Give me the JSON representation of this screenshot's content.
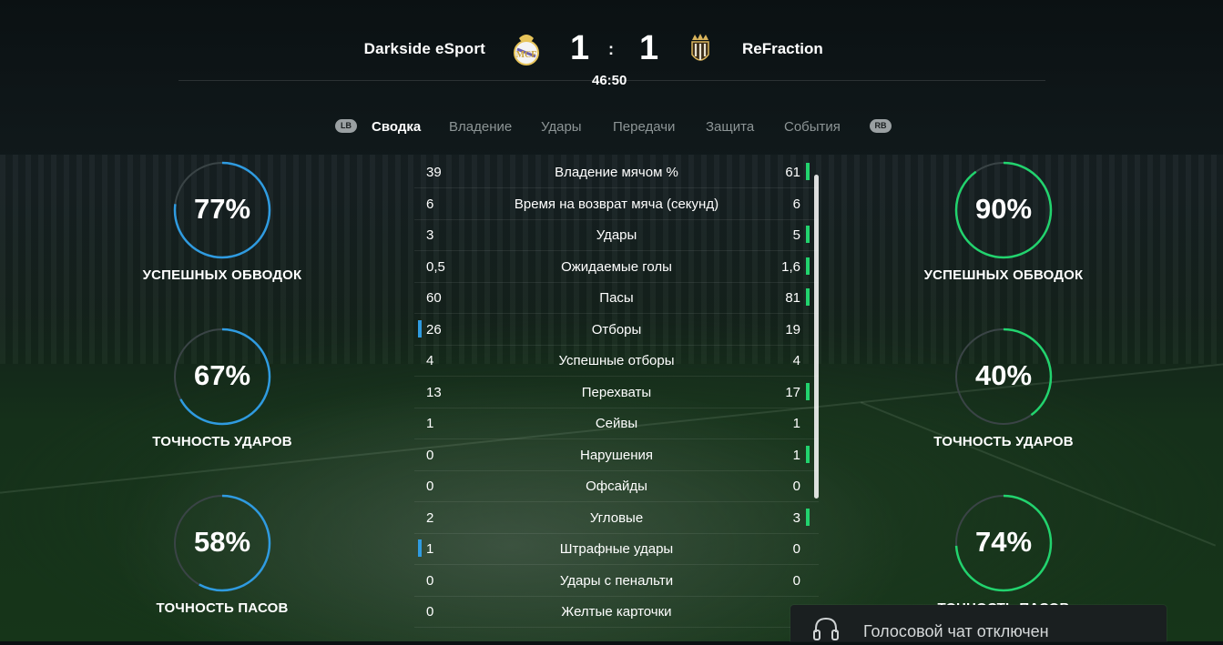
{
  "header": {
    "home_team": "Darkside eSport",
    "away_team": "ReFraction",
    "home_score": "1",
    "away_score": "1",
    "separator": ":",
    "match_time": "46:50",
    "home_crest": "real-madrid-crest-icon",
    "away_crest": "crown-crest-icon"
  },
  "tabs": {
    "lb": "LB",
    "rb": "RB",
    "items": [
      "Сводка",
      "Владение",
      "Удары",
      "Передачи",
      "Защита",
      "События"
    ],
    "active": "Сводка"
  },
  "stats": [
    {
      "home": "39",
      "label": "Владение мячом %",
      "away": "61",
      "leader": "away"
    },
    {
      "home": "6",
      "label": "Время на возврат мяча (секунд)",
      "away": "6",
      "leader": "none"
    },
    {
      "home": "3",
      "label": "Удары",
      "away": "5",
      "leader": "away"
    },
    {
      "home": "0,5",
      "label": "Ожидаемые голы",
      "away": "1,6",
      "leader": "away"
    },
    {
      "home": "60",
      "label": "Пасы",
      "away": "81",
      "leader": "away"
    },
    {
      "home": "26",
      "label": "Отборы",
      "away": "19",
      "leader": "home"
    },
    {
      "home": "4",
      "label": "Успешные отборы",
      "away": "4",
      "leader": "none"
    },
    {
      "home": "13",
      "label": "Перехваты",
      "away": "17",
      "leader": "away"
    },
    {
      "home": "1",
      "label": "Сейвы",
      "away": "1",
      "leader": "none"
    },
    {
      "home": "0",
      "label": "Нарушения",
      "away": "1",
      "leader": "away"
    },
    {
      "home": "0",
      "label": "Офсайды",
      "away": "0",
      "leader": "none"
    },
    {
      "home": "2",
      "label": "Угловые",
      "away": "3",
      "leader": "away"
    },
    {
      "home": "1",
      "label": "Штрафные удары",
      "away": "0",
      "leader": "home"
    },
    {
      "home": "0",
      "label": "Удары с пенальти",
      "away": "0",
      "leader": "none"
    },
    {
      "home": "0",
      "label": "Желтые карточки",
      "away": "",
      "leader": "none"
    }
  ],
  "home_rings": [
    {
      "value": "77%",
      "label": "УСПЕШНЫХ ОБВОДОК",
      "fraction": 0.77
    },
    {
      "value": "67%",
      "label": "ТОЧНОСТЬ УДАРОВ",
      "fraction": 0.67
    },
    {
      "value": "58%",
      "label": "ТОЧНОСТЬ ПАСОВ",
      "fraction": 0.58
    }
  ],
  "away_rings": [
    {
      "value": "90%",
      "label": "УСПЕШНЫХ ОБВОДОК",
      "fraction": 0.9
    },
    {
      "value": "40%",
      "label": "ТОЧНОСТЬ УДАРОВ",
      "fraction": 0.4
    },
    {
      "value": "74%",
      "label": "ТОЧНОСТЬ ПАСОВ",
      "fraction": 0.74
    }
  ],
  "colors": {
    "home_accent": "#2f9be0",
    "away_accent": "#22d36e",
    "ring_track": "#3a4446"
  },
  "toast": {
    "icon": "headset-icon",
    "text": "Голосовой чат отключен"
  }
}
